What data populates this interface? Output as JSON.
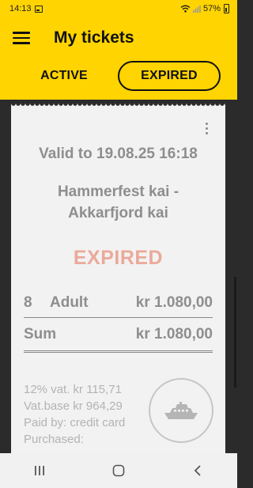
{
  "status_bar": {
    "time": "14:13",
    "battery": "57%"
  },
  "app_bar": {
    "title": "My tickets"
  },
  "tabs": [
    {
      "label": "ACTIVE",
      "selected": false
    },
    {
      "label": "EXPIRED",
      "selected": true
    }
  ],
  "ticket": {
    "valid_to": "Valid to 19.08.25 16:18",
    "route_line1": "Hammerfest kai -",
    "route_line2": "Akkarfjord kai",
    "status": "EXPIRED",
    "line_item": {
      "quantity": "8",
      "type": "Adult",
      "price": "kr 1.080,00"
    },
    "sum": {
      "label": "Sum",
      "price": "kr 1.080,00"
    },
    "vat": "12% vat. kr 115,71",
    "vat_base": "Vat.base kr 964,29",
    "paid_by": "Paid by: credit card",
    "purchased": "Purchased:",
    "icon": "ferry-icon"
  },
  "colors": {
    "accent": "#ffd400",
    "expired": "#eba99a",
    "muted_text": "#8e8e8e",
    "dark_bg": "#2b2b2b"
  }
}
